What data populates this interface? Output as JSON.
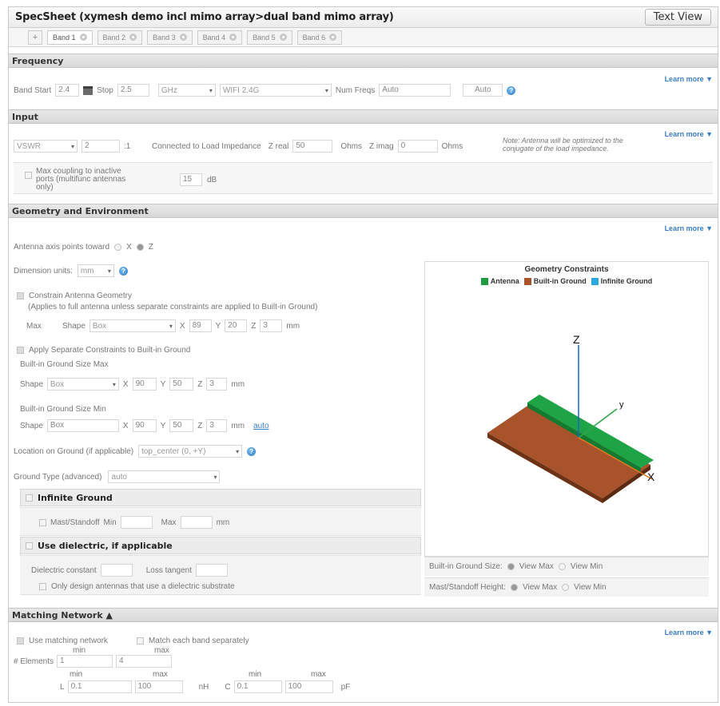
{
  "window": {
    "title": "SpecSheet (xymesh demo incl mimo array>dual band mimo array)",
    "text_view_label": "Text View"
  },
  "tabs": [
    {
      "label": "Band 1"
    },
    {
      "label": "Band 2"
    },
    {
      "label": "Band 3"
    },
    {
      "label": "Band 4"
    },
    {
      "label": "Band 5"
    },
    {
      "label": "Band 6"
    }
  ],
  "add_tab_label": "+",
  "learn_more": "Learn more ▼",
  "frequency": {
    "header": "Frequency",
    "band_start_label": "Band Start",
    "band_start": "2.4",
    "stop_label": "Stop",
    "stop": "2.5",
    "unit": "GHz",
    "preset": "WIFI 2.4G",
    "num_freqs_label": "Num Freqs",
    "num_freqs": "Auto",
    "auto_button": "Auto"
  },
  "input": {
    "header": "Input",
    "metric": "VSWR",
    "vswr": "2",
    "ratio_suffix": ":1",
    "connected_label": "Connected to Load Impedance",
    "zreal_label": "Z real",
    "zreal": "50",
    "ohms": "Ohms",
    "zimag_label": "Z imag",
    "zimag": "0",
    "note": "Note: Antenna will be optimized to the conjugate of the load impedance.",
    "coupling_label": "Max coupling to inactive ports (multifunc antennas only)",
    "coupling_value": "15",
    "coupling_unit": "dB"
  },
  "geometry": {
    "header": "Geometry and Environment",
    "axis_label": "Antenna axis points toward",
    "axis_x": "X",
    "axis_z": "Z",
    "dim_units_label": "Dimension units:",
    "dim_units": "mm",
    "constrain_label": "Constrain Antenna Geometry",
    "constrain_note": "(Applies to full antenna unless separate constraints are applied to Built-in Ground)",
    "max_label": "Max",
    "shape_label": "Shape",
    "shape": "Box",
    "x_label": "X",
    "y_label": "Y",
    "z_label": "Z",
    "mm": "mm",
    "ant_x": "89",
    "ant_y": "20",
    "ant_z": "3",
    "apply_sep_label": "Apply Separate Constraints to Built-in Ground",
    "bg_max_label": "Built-in Ground Size Max",
    "bg_max_x": "90",
    "bg_max_y": "50",
    "bg_max_z": "3",
    "bg_min_label": "Built-in Ground Size Min",
    "bg_min_x": "90",
    "bg_min_y": "50",
    "bg_min_z": "3",
    "auto_link": "auto",
    "location_label": "Location on Ground (if applicable)",
    "location": "top_center (0, +Y)",
    "ground_type_label": "Ground Type (advanced)",
    "ground_type": "auto",
    "infinite_ground_title": "Infinite Ground",
    "mast_label": "Mast/Standoff",
    "min_label": "Min",
    "max_label2": "Max",
    "dielectric_title": "Use dielectric, if applicable",
    "dielectric_const_label": "Dielectric constant",
    "loss_tangent_label": "Loss tangent",
    "only_dielectric_label": "Only design antennas that use a dielectric substrate"
  },
  "chart": {
    "title": "Geometry Constraints",
    "legend": [
      {
        "name": "Antenna",
        "color": "#1f9b3f"
      },
      {
        "name": "Built-in Ground",
        "color": "#a9532a"
      },
      {
        "name": "Infinite Ground",
        "color": "#2aa8e0"
      }
    ],
    "axis_z": "Z",
    "axis_y": "y",
    "axis_x": "X",
    "bg_size_label": "Built-in Ground Size:",
    "view_max": "View Max",
    "view_min": "View Min",
    "mast_height_label": "Mast/Standoff Height:"
  },
  "matching": {
    "header": "Matching Network ▲",
    "use_label": "Use matching network",
    "each_band_label": "Match each band separately",
    "min_label": "min",
    "max_label": "max",
    "elements_label": "# Elements",
    "elements_min": "1",
    "elements_max": "4",
    "l_label": "L",
    "l_min": "0.1",
    "l_max": "100",
    "l_unit": "nH",
    "c_label": "C",
    "c_min": "0.1",
    "c_max": "100",
    "c_unit": "pF"
  }
}
